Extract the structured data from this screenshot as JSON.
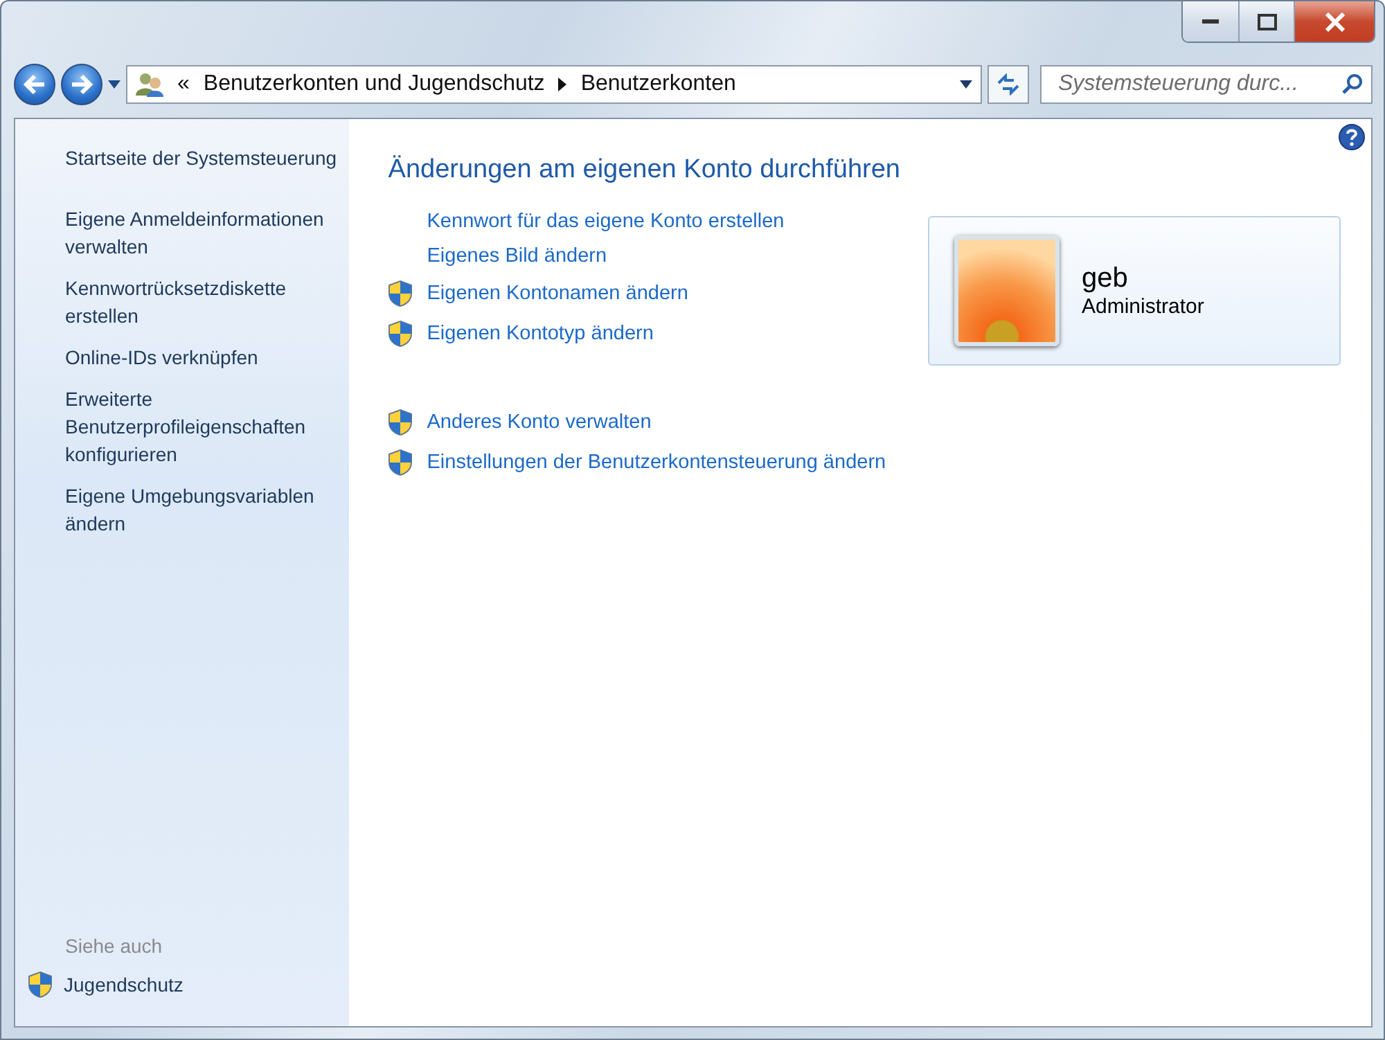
{
  "address_bar": {
    "overflow": "«",
    "crumbs": [
      "Benutzerkonten und Jugendschutz",
      "Benutzerkonten"
    ]
  },
  "search": {
    "placeholder": "Systemsteuerung durc..."
  },
  "sidebar": {
    "home": "Startseite der Systemsteuerung",
    "tasks": [
      "Eigene Anmeldeinformationen verwalten",
      "Kennwortrücksetzdiskette erstellen",
      "Online-IDs verknüpfen",
      "Erweiterte Benutzerprofileigenschaften konfigurieren",
      "Eigene Umgebungsvariablen ändern"
    ],
    "see_also_title": "Siehe auch",
    "see_also": [
      {
        "label": "Jugendschutz",
        "shield": true
      }
    ]
  },
  "main": {
    "heading": "Änderungen am eigenen Konto durchführen",
    "link_groups": [
      [
        {
          "label": "Kennwort für das eigene Konto erstellen",
          "shield": false
        },
        {
          "label": "Eigenes Bild ändern",
          "shield": false
        },
        {
          "label": "Eigenen Kontonamen ändern",
          "shield": true
        },
        {
          "label": "Eigenen Kontotyp ändern",
          "shield": true
        }
      ],
      [
        {
          "label": "Anderes Konto verwalten",
          "shield": true
        },
        {
          "label": "Einstellungen der Benutzerkontensteuerung ändern",
          "shield": true
        }
      ]
    ]
  },
  "account": {
    "name": "geb",
    "type": "Administrator"
  }
}
